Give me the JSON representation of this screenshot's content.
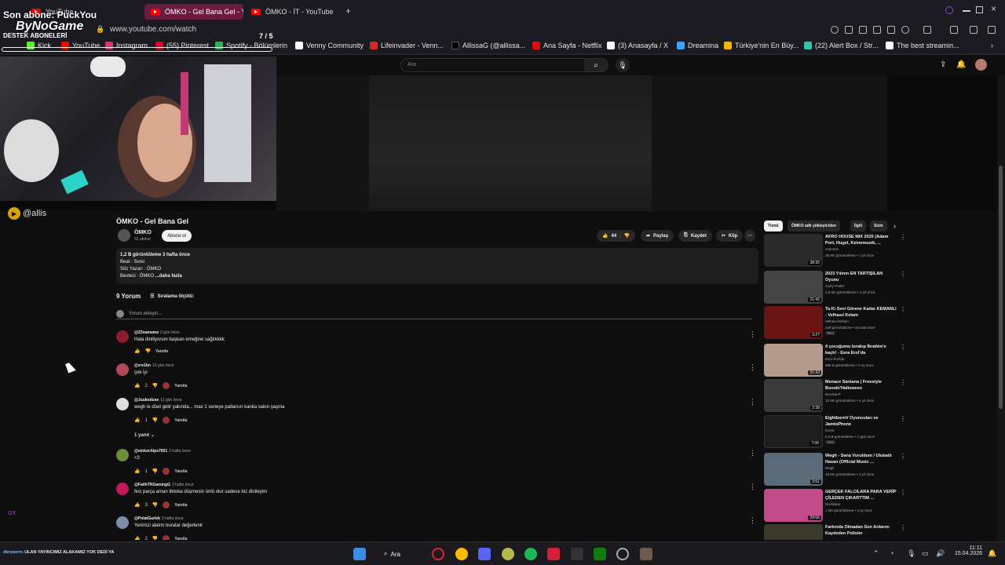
{
  "browser": {
    "tabs": [
      {
        "label": "YouTube"
      },
      {
        "label": "ÖMKO - Gel Bana Gel - Yo"
      },
      {
        "label": "ÖMKO - İT - YouTube"
      }
    ],
    "url": "www.youtube.com/watch",
    "bookmarks": [
      {
        "label": "Kick",
        "color": "#53fc18"
      },
      {
        "label": "YouTube",
        "color": "#ff0000"
      },
      {
        "label": "Instagram",
        "color": "#e1306c"
      },
      {
        "label": "(55) Pinterest",
        "color": "#e60023"
      },
      {
        "label": "Spotify - Bölümlerin",
        "color": "#1db954"
      },
      {
        "label": "Venny Community",
        "color": "#ffffff"
      },
      {
        "label": "Lifeinvader - Venn...",
        "color": "#d62828"
      },
      {
        "label": "AllissaG (@allissa...",
        "color": "#000000"
      },
      {
        "label": "Ana Sayfa - Netflix",
        "color": "#e50914"
      },
      {
        "label": "(3) Anasayfa / X",
        "color": "#ffffff"
      },
      {
        "label": "Dreamina",
        "color": "#3aa3ff"
      },
      {
        "label": "Türkiye'nin En Büy...",
        "color": "#f7b500"
      },
      {
        "label": "(22) Alert Box / Str...",
        "color": "#32c3a6"
      },
      {
        "label": "The best streamin...",
        "color": "#ffffff"
      }
    ]
  },
  "stream_overlay": {
    "title": "Son abone: PuckYou",
    "name": "ByNoGame",
    "subs_label": "DESTEK ABONELERİ",
    "sub_count": "7 / 5",
    "handle": "@allis"
  },
  "yt_header": {
    "search_placeholder": "Ara"
  },
  "video": {
    "title": "ÖMKO - Gel Bana Gel",
    "channel": "ÖMKO",
    "subscribers": "31 abone",
    "subscribe_label": "Abone ol",
    "likes": "44",
    "share_label": "Paylaş",
    "save_label": "Kaydet",
    "clip_label": "Klip",
    "description": {
      "line1": "1,2 B görüntüleme  3 hafta önce",
      "line2": "Beat : Suno",
      "line3": "Söz Yazarı : ÖMKO",
      "line4": "Besteci : ÖMKO",
      "more": "...daha fazla"
    }
  },
  "comments": {
    "count_label": "9 Yorum",
    "sort_label": "Sıralama ölçütü:",
    "add_placeholder": "Yorum ekleyin...",
    "reply_label": "Yanıtla",
    "replies_toggle": "1 yanıt",
    "items": [
      {
        "user": "@Z3oamama",
        "time": "2 gün önce",
        "text": "Hala diniliyorum başkan emeğine sağlıkkkk",
        "likes": "",
        "avatar": "#8b1d2c"
      },
      {
        "user": "@zre1bn",
        "time": "10 gün önce",
        "text": "çok iyi",
        "likes": "2",
        "avatar": "#b0485a"
      },
      {
        "user": "@Juukoduse",
        "time": "11 gün önce",
        "text": "wegh le düet gelir yakında... max 1 seneye patlarsın kanka sakın şaşma",
        "likes": "1",
        "avatar": "#dddddd"
      },
      {
        "user": "@sinkochips7601",
        "time": "3 hafta önce",
        "text": "<3",
        "likes": "1",
        "avatar": "#6b8e3a"
      },
      {
        "user": "@FatihTRGamingG",
        "time": "3 hafta önce",
        "text": "feci parça aman tiktoka düşmesin ünlü olur sadece biz dinileyim",
        "likes": "3",
        "avatar": "#c2185b"
      },
      {
        "user": "@PolatGurlek",
        "time": "3 hafta önce",
        "text": "Yerimizi alalım buralar değerlenir",
        "likes": "2",
        "avatar": "#7d8fa8"
      }
    ]
  },
  "chips": [
    {
      "label": "Tümü",
      "active": true
    },
    {
      "label": "ÖMKO adlı yükleyiciden",
      "active": false
    },
    {
      "label": "İlgili",
      "active": false
    },
    {
      "label": "Sizin",
      "active": false
    }
  ],
  "recommendations": [
    {
      "title": "AFRO HOUSE MIX 2025 (Adam Port, Hugel, Keinemusik, ...",
      "channel": "Joanson",
      "meta": "25 Mn görüntüleme • 1 yıl önce",
      "duration": "38:35",
      "badge": "",
      "thumb": "#2b2b2b"
    },
    {
      "title": "2023 Yılının EN TARTIŞILAN Oyunu",
      "channel": "Carry Potter",
      "meta": "1,5 Mn görüntüleme • 2 yıl önce",
      "duration": "21:42",
      "badge": "",
      "thumb": "#444444"
    },
    {
      "title": "Ta Ki Seni Görene Kadar KEMANLI - Velhasıl Kelam",
      "channel": "Velhasıl Kelam",
      "meta": "248 görüntüleme • 23 saat önce",
      "duration": "3:27",
      "badge": "Yeni",
      "thumb": "#6a1414"
    },
    {
      "title": "4 çocuğumu bırakıp İbrahim'e kaçtı! - Esra Erol'da",
      "channel": "Esra Erol'da",
      "meta": "580 B görüntüleme • 2 ay önce",
      "duration": "31:33",
      "badge": "",
      "thumb": "#b39a8a"
    },
    {
      "title": "Menace Santana | Freestyle Boooki'Halloween",
      "channel": "Boooka-P",
      "meta": "12 Mn görüntüleme • 4 yıl önce",
      "duration": "2:38",
      "badge": "",
      "thumb": "#3a3a3a"
    },
    {
      "title": "EightbornV Oyuncuları ve JamtoPhone",
      "channel": "Ecem",
      "meta": "6,3 B görüntüleme • 2 gün önce",
      "duration": "7:06",
      "badge": "Yeni",
      "thumb": "#1e1e1e"
    },
    {
      "title": "Wegh - Sana Vuruldum / Ulubatlı Hasan (Official Music ...",
      "channel": "Wegh",
      "meta": "19 Mn görüntüleme • 1 yıl önce",
      "duration": "3:51",
      "badge": "",
      "thumb": "#5a6a78"
    },
    {
      "title": "GERÇEK FALCILARA PARA VERİP ÇİLEDEN ÇIKARTTIM ...",
      "channel": "Nordisina",
      "meta": "1 Mn görüntüleme • 2 ay önce",
      "duration": "29:06",
      "badge": "",
      "thumb": "#c24a8a"
    },
    {
      "title": "Farkında Olmadan Son Anlarını Kaydeden Polisler",
      "channel": "",
      "meta": "",
      "duration": "",
      "badge": "",
      "thumb": "#3a3a2a"
    }
  ],
  "taskbar": {
    "ticker_user": "dbryanrn",
    "ticker_text": ": ULAN YAYINCIMIZ ALAKAMIZ YOK DEDİ YA",
    "search_label": "Ara",
    "time": "11:11",
    "date": "15.04.2026"
  },
  "sidebar": {
    "gx_label": "GX"
  }
}
